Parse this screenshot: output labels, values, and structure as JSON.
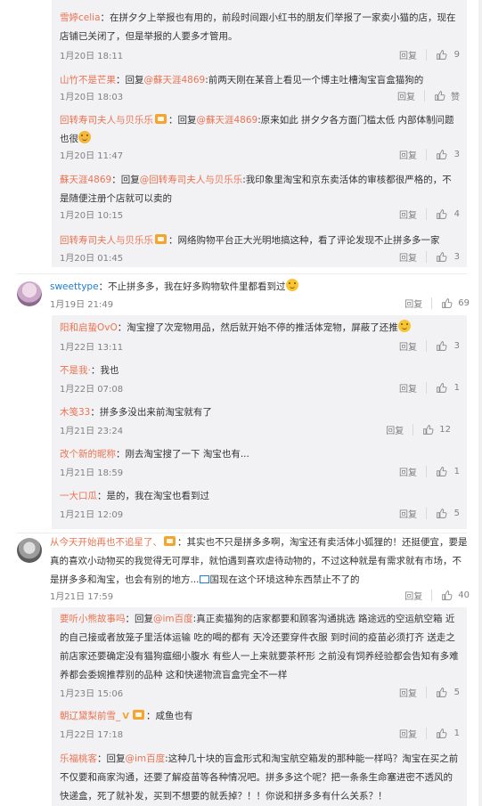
{
  "labels": {
    "reply": "回复",
    "reply_to": "回复"
  },
  "comments": [
    {
      "user": "雪婷celia",
      "sep": "：",
      "text": "在拼夕夕上举报也有用的，前段时间跟小红书的朋友们举报了一家卖小猫的店，现在店铺已关闭了，但是举报的人要多才管用。",
      "time": "1月20日 18:11",
      "likes": "9"
    },
    {
      "user": "山竹不是芒果",
      "mention": "@蘇天涯4869",
      "text": ":前两天刚在某音上看见一个博主吐槽淘宝盲盒猫狗的",
      "time": "1月20日 18:03",
      "likes": "赞"
    },
    {
      "user": "回转寿司夫人与贝乐乐",
      "mention": "@蘇天涯4869",
      "text": ":原来如此 拼夕夕各方面门槛太低 内部体制问题也很",
      "time": "1月20日 11:47",
      "likes": "3"
    },
    {
      "user": "蘇天涯4869",
      "mention": "@回转寿司夫人与贝乐乐",
      "text": ":我印象里淘宝和京东卖活体的审核都很严格的，不是随便注册个店就可以卖的",
      "time": "1月20日 10:15",
      "likes": "4"
    },
    {
      "user": "回转寿司夫人与贝乐乐",
      "sep": "：",
      "text": "网络购物平台正大光明地搞这种，看了评论发现不止拼多多一家",
      "time": "1月20日 01:45",
      "likes": "3"
    },
    {
      "user": "sweettype",
      "sep": "：",
      "text": "不止拼多多，我在好多购物软件里都看到过",
      "time": "1月19日 21:49",
      "likes": "69"
    },
    {
      "user": "阳和启蛰OvO",
      "sep": "：",
      "text": "淘宝搜了次宠物用品，然后就开始不停的推活体宠物，屏蔽了还推",
      "time": "1月22日 13:11",
      "likes": "3"
    },
    {
      "user": "不是我·",
      "sep": "：",
      "text": "我也",
      "time": "1月22日 07:08",
      "likes": "1"
    },
    {
      "user": "木笺33",
      "sep": "：",
      "text": "拼多多没出来前淘宝就有了",
      "time": "1月21日 23:24",
      "likes": "12"
    },
    {
      "user": "改个新的昵称",
      "sep": "：",
      "text": "刚去淘宝搜了一下 淘宝也有...",
      "time": "1月21日 18:59",
      "likes": "1"
    },
    {
      "user": "一大口瓜",
      "sep": "：",
      "text": "是的，我在淘宝也看到过",
      "time": "1月21日 12:09",
      "likes": "5"
    },
    {
      "user": "从今天开始再也不追星了、",
      "sep": "：",
      "text": "其实也不只是拼多多啊，淘宝还有卖活体小狐狸的！还挺便宜，要是真的喜欢小动物买的我觉得无可厚非，就怕遇到喜欢虐待动物的，不过这种就是有需求就有市场，不是拼多多和淘宝，也会有别的地方...",
      "link": "国现在这个环境这种东西禁止不了的",
      "time": "1月21日 17:59",
      "likes": "40"
    },
    {
      "user": "要听小熊故事吗",
      "mention": "@im百度",
      "text": ":真正卖猫狗的店家都要和顾客沟通挑选 路途远的空运航空箱 近的自己接或者放笼子里活体运输 吃的喝的都有 天冷还要穿件衣服 到时间的疫苗必须打齐 送走之前店家还要确定没有猫狗瘟细小腹水 有些人一上来就要茶杯形 之前没有饲养经验都会告知有多难养都会委婉推荐别的品种 这和快递物流盲盒完全不一样",
      "time": "1月23日 15:06",
      "likes": "5"
    },
    {
      "user": "朝辽黛梨前雪_",
      "sep": "：",
      "text": "咸鱼也有",
      "time": "1月22日 17:18",
      "likes": "1"
    },
    {
      "user": "乐福桃客",
      "mention": "@im百度",
      "text": ":这种几十块的盲盒形式和淘宝航空箱发的那种能一样吗？淘宝在买之前不仅要和商家沟通，还要了解疫苗等各种情况吧。拼多多这个呢？把一条条生命塞进密不透风的快递盒，死了就补发，买到不想要的就丢掉？！！你说和拼多多有什么关系？！"
    }
  ]
}
